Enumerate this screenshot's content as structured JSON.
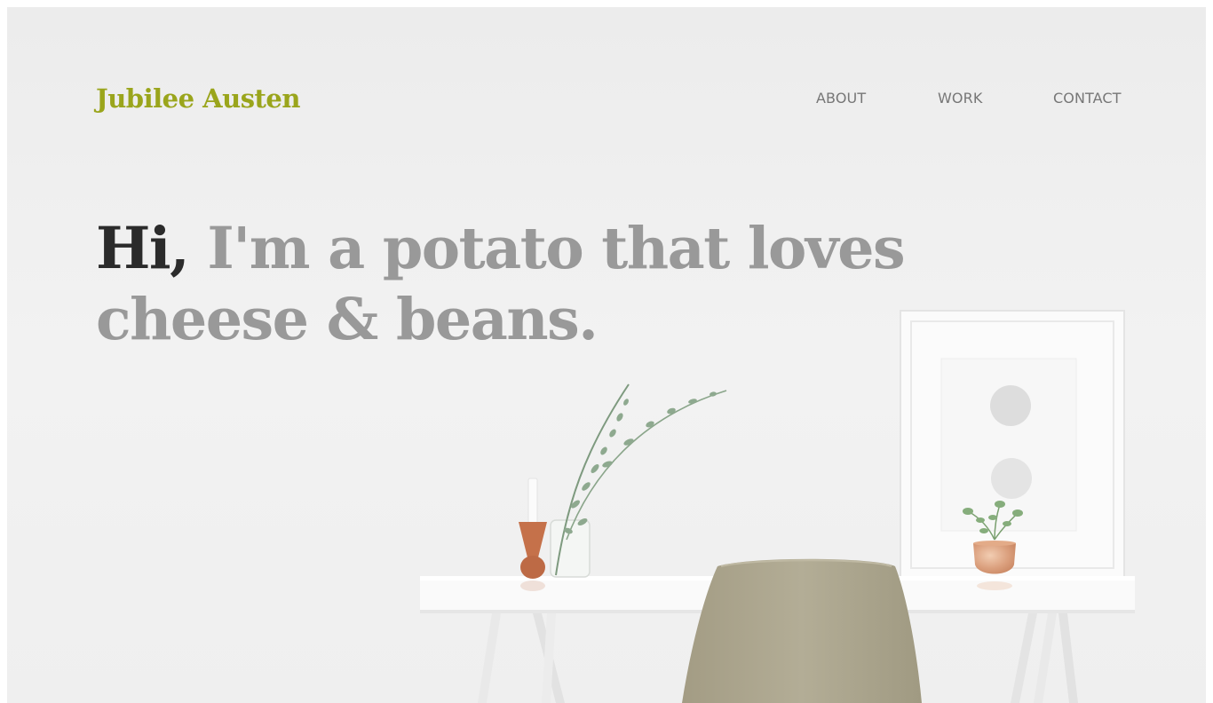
{
  "header": {
    "brand": "Jubilee Austen",
    "nav": {
      "about": "ABOUT",
      "work": "WORK",
      "contact": "CONTACT"
    }
  },
  "hero": {
    "greeting": "Hi,",
    "line1_rest": "I'm a potato that loves",
    "line2": "cheese & beans."
  },
  "colors": {
    "brand": "#9aa51c",
    "nav_text": "#777777",
    "greeting": "#2b2b2b",
    "headline": "#999999",
    "background": "#f0f0f0"
  },
  "scene": {
    "objects": [
      "desk",
      "chair",
      "picture-frame",
      "candle-holder",
      "glass-vase-with-eucalyptus",
      "copper-pot-plant"
    ]
  }
}
